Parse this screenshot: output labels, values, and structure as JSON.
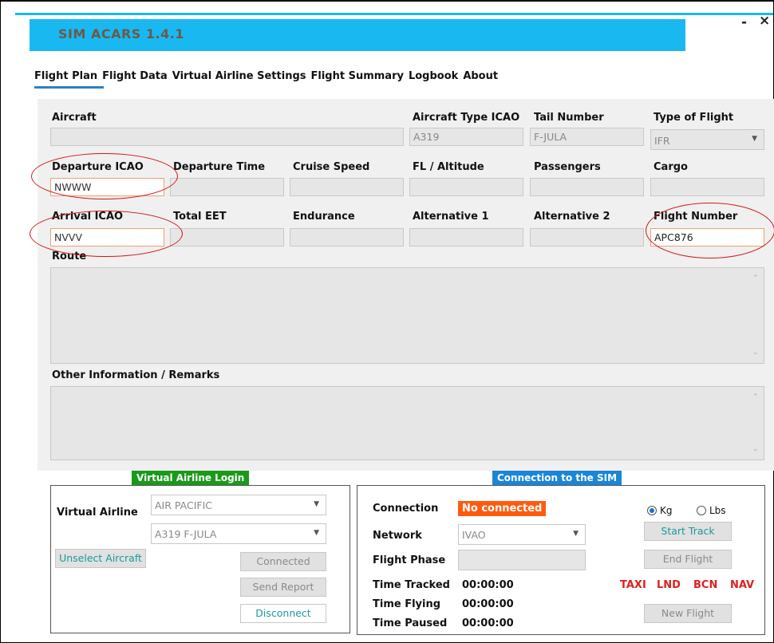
{
  "window": {
    "title": "SIM ACARS  1.4.1",
    "minimize_glyph": "-",
    "close_glyph": "×",
    "accent_color": "#1ab8f0"
  },
  "menu": [
    {
      "label": "Flight Plan"
    },
    {
      "label": "Flight Data"
    },
    {
      "label": "Virtual Airline Settings"
    },
    {
      "label": "Flight Summary"
    },
    {
      "label": "Logbook"
    },
    {
      "label": "About"
    }
  ],
  "flight_plan": {
    "aircraft": {
      "label": "Aircraft",
      "value": ""
    },
    "aircraft_type": {
      "label": "Aircraft Type ICAO",
      "value": "A319"
    },
    "tail_number": {
      "label": "Tail Number",
      "value": "F-JULA"
    },
    "type_of_flight": {
      "label": "Type of Flight",
      "value": "IFR"
    },
    "departure_icao": {
      "label": "Departure ICAO",
      "value": "NWWW"
    },
    "departure_time": {
      "label": "Departure Time",
      "value": ""
    },
    "cruise_speed": {
      "label": "Cruise Speed",
      "value": ""
    },
    "fl_altitude": {
      "label": "FL / Altitude",
      "value": ""
    },
    "passengers": {
      "label": "Passengers",
      "value": ""
    },
    "cargo": {
      "label": "Cargo",
      "value": ""
    },
    "arrival_icao": {
      "label": "Arrival ICAO",
      "value": "NVVV"
    },
    "total_eet": {
      "label": "Total EET",
      "value": ""
    },
    "endurance": {
      "label": "Endurance",
      "value": ""
    },
    "alternative_1": {
      "label": "Alternative 1",
      "value": ""
    },
    "alternative_2": {
      "label": "Alternative 2",
      "value": ""
    },
    "flight_number": {
      "label": "Flight Number",
      "value": "APC876"
    },
    "route": {
      "label": "Route",
      "value": ""
    },
    "remarks": {
      "label": "Other Information / Remarks",
      "value": ""
    }
  },
  "va_login": {
    "header": "Virtual Airline Login",
    "header_color": "#1a9a1a",
    "airline_label": "Virtual Airline",
    "airline_value": "AIR PACIFIC",
    "aircraft_value": "A319 F-JULA",
    "unselect_button": "Unselect Aircraft",
    "connected_button": "Connected",
    "send_report_button": "Send Report",
    "disconnect_button": "Disconnect"
  },
  "sim_connection": {
    "header": "Connection to the SIM",
    "header_color": "#1a86d8",
    "connection_label": "Connection",
    "connection_status": "No connected",
    "status_color": "#ff5a10",
    "network_label": "Network",
    "network_value": "IVAO",
    "flight_phase_label": "Flight Phase",
    "flight_phase_value": "",
    "time_tracked_label": "Time Tracked",
    "time_tracked_value": "00:00:00",
    "time_flying_label": "Time Flying",
    "time_flying_value": "00:00:00",
    "time_paused_label": "Time Paused",
    "time_paused_value": "00:00:00",
    "unit_kg": "Kg",
    "unit_lbs": "Lbs",
    "unit_selected": "Kg",
    "start_track_button": "Start Track",
    "end_flight_button": "End Flight",
    "new_flight_button": "New Flight",
    "phases": [
      "TAXI",
      "LND",
      "BCN",
      "NAV"
    ],
    "phase_color": "#e02020"
  }
}
